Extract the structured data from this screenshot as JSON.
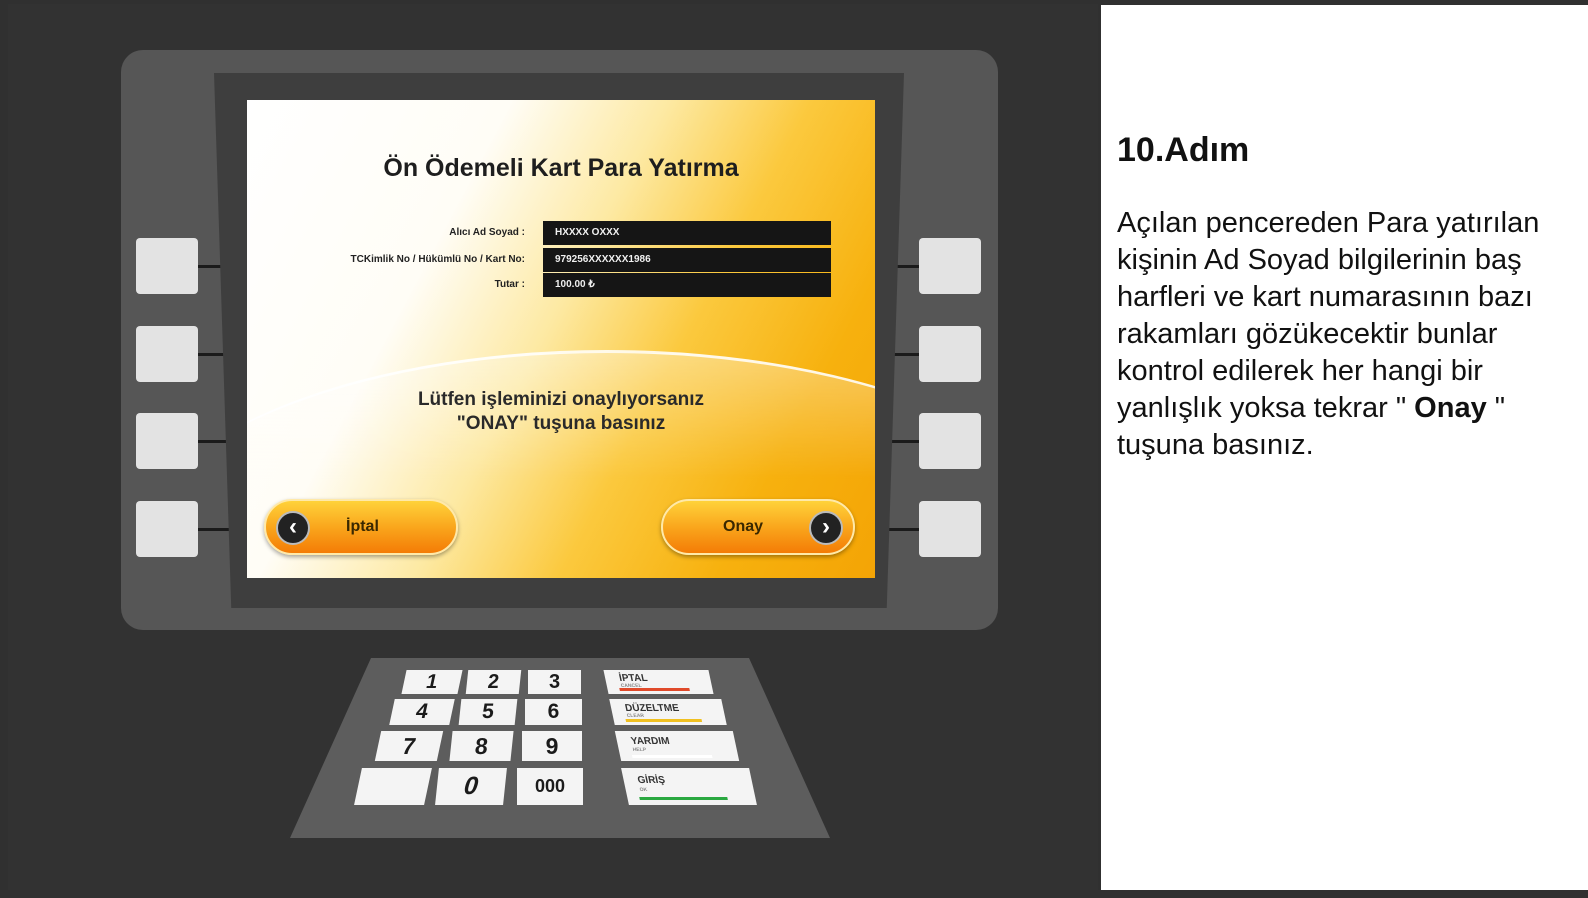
{
  "screen": {
    "title": "Ön Ödemeli Kart Para Yatırma",
    "fields": [
      {
        "label": "Alıcı Ad Soyad :",
        "value": "HXXXX  OXXX"
      },
      {
        "label": "TCKimlik No / Hükümlü No / Kart No:",
        "value": "979256XXXXXX1986"
      },
      {
        "label": "Tutar :",
        "value": "100.00 ₺"
      }
    ],
    "confirm_message": {
      "line1": "Lütfen işleminizi onaylıyorsanız",
      "line2": "\"ONAY\" tuşuna basınız"
    },
    "cancel_button": {
      "label": "İptal",
      "icon": "chevron-left-icon"
    },
    "confirm_button": {
      "label": "Onay",
      "icon": "chevron-right-icon"
    }
  },
  "keypad": {
    "digits": [
      "1",
      "2",
      "3",
      "4",
      "5",
      "6",
      "7",
      "8",
      "9",
      "0",
      "000"
    ],
    "function_keys": [
      {
        "label": "İPTAL",
        "sub": "CANCEL",
        "color": "#e04a2a"
      },
      {
        "label": "DÜZELTME",
        "sub": "CLEAR",
        "color": "#f0c020"
      },
      {
        "label": "YARDIM",
        "sub": "HELP",
        "color": "#ffffff"
      },
      {
        "label": "GİRİŞ",
        "sub": "OK",
        "color": "#2aa840"
      }
    ]
  },
  "instructions": {
    "step_title": "10.Adım",
    "text_before": "Açılan pencereden Para yatırılan kişinin Ad Soyad bilgilerinin baş harfleri ve kart numarasının bazı rakamları gözükecektir bunlar kontrol edilerek her hangi  bir yanlışlık yoksa tekrar \" ",
    "text_bold": "Onay",
    "text_after": " \" tuşuna basınız."
  }
}
